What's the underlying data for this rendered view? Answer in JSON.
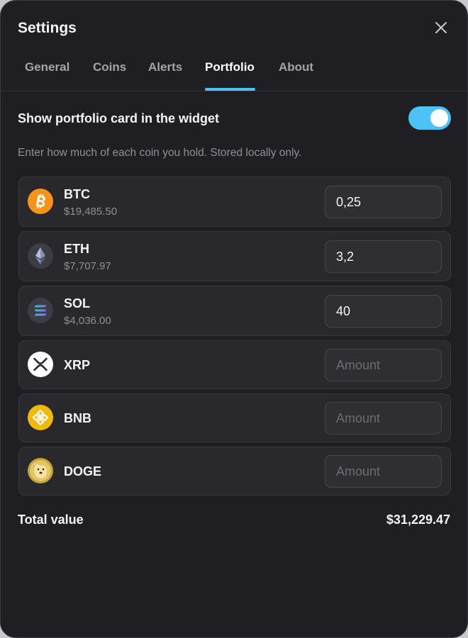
{
  "window": {
    "title": "Settings"
  },
  "tabs": [
    {
      "label": "General",
      "active": false
    },
    {
      "label": "Coins",
      "active": false
    },
    {
      "label": "Alerts",
      "active": false
    },
    {
      "label": "Portfolio",
      "active": true
    },
    {
      "label": "About",
      "active": false
    }
  ],
  "portfolio_toggle": {
    "label": "Show portfolio card in the widget",
    "enabled": true
  },
  "hint": "Enter how much of each coin you hold. Stored locally only.",
  "coins": [
    {
      "symbol": "BTC",
      "value": "$19,485.50",
      "amount": "0,25",
      "placeholder": "Amount",
      "icon": "bitcoin-icon",
      "icon_color": "#f7931a"
    },
    {
      "symbol": "ETH",
      "value": "$7,707.97",
      "amount": "3,2",
      "placeholder": "Amount",
      "icon": "ethereum-icon",
      "icon_color": "#3c3c44"
    },
    {
      "symbol": "SOL",
      "value": "$4,036.00",
      "amount": "40",
      "placeholder": "Amount",
      "icon": "solana-icon",
      "icon_color": "#3c3c44"
    },
    {
      "symbol": "XRP",
      "value": "",
      "amount": "",
      "placeholder": "Amount",
      "icon": "xrp-icon",
      "icon_color": "#ffffff"
    },
    {
      "symbol": "BNB",
      "value": "",
      "amount": "",
      "placeholder": "Amount",
      "icon": "bnb-icon",
      "icon_color": "#f0b90b"
    },
    {
      "symbol": "DOGE",
      "value": "",
      "amount": "",
      "placeholder": "Amount",
      "icon": "dogecoin-icon",
      "icon_color": "#c2a633"
    }
  ],
  "total": {
    "label": "Total value",
    "value": "$31,229.47"
  },
  "colors": {
    "accent": "#4cc2f5",
    "background": "#1f1f23",
    "row_background": "#29292d"
  }
}
